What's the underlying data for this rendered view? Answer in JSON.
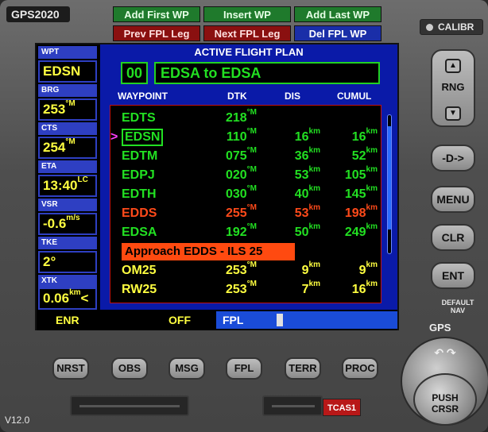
{
  "brand": "GPS2020",
  "top_buttons": [
    {
      "label": "Add First WP",
      "color": "green"
    },
    {
      "label": "Insert WP",
      "color": "green"
    },
    {
      "label": "Add Last WP",
      "color": "green"
    },
    {
      "label": "Prev FPL Leg",
      "color": "red"
    },
    {
      "label": "Next FPL Leg",
      "color": "red"
    },
    {
      "label": "Del FPL WP",
      "color": "blue"
    }
  ],
  "calibr": "CALIBR",
  "left_panel": {
    "wpt": {
      "label": "WPT",
      "value": "EDSN"
    },
    "brg": {
      "label": "BRG",
      "value": "253",
      "unit": "°M"
    },
    "cts": {
      "label": "CTS",
      "value": "254",
      "unit": "°M"
    },
    "eta": {
      "label": "ETA",
      "value": "13:40",
      "unit": "LC"
    },
    "vsr": {
      "label": "VSR",
      "value": "-0.6",
      "unit": "m/s"
    },
    "tke": {
      "label": "TKE",
      "value": "2°"
    },
    "xtk": {
      "label": "XTK",
      "value": "0.06",
      "unit": "km",
      "suffix": "<"
    }
  },
  "flight_plan": {
    "title": "ACTIVE FLIGHT PLAN",
    "number": "00",
    "name": "EDSA to EDSA",
    "columns": {
      "waypoint": "WAYPOINT",
      "dtk": "DTK",
      "dis": "DIS",
      "cumul": "CUMUL"
    },
    "rows": [
      {
        "wp": "EDTS",
        "dtk": "218",
        "dis": "",
        "cum": "",
        "color": "green",
        "active": false
      },
      {
        "wp": "EDSN",
        "dtk": "110",
        "dis": "16",
        "cum": "16",
        "color": "green",
        "active": true
      },
      {
        "wp": "EDTM",
        "dtk": "075",
        "dis": "36",
        "cum": "52",
        "color": "green",
        "active": false
      },
      {
        "wp": "EDPJ",
        "dtk": "020",
        "dis": "53",
        "cum": "105",
        "color": "green",
        "active": false
      },
      {
        "wp": "EDTH",
        "dtk": "030",
        "dis": "40",
        "cum": "145",
        "color": "green",
        "active": false
      },
      {
        "wp": "EDDS",
        "dtk": "255",
        "dis": "53",
        "cum": "198",
        "color": "red",
        "active": false
      },
      {
        "wp": "EDSA",
        "dtk": "192",
        "dis": "50",
        "cum": "249",
        "color": "green",
        "active": false
      }
    ],
    "approach": "Approach EDDS - ILS 25",
    "approach_rows": [
      {
        "wp": "OM25",
        "dtk": "253",
        "dis": "9",
        "cum": "9",
        "color": "yellow"
      },
      {
        "wp": "RW25",
        "dtk": "253",
        "dis": "7",
        "cum": "16",
        "color": "yellow"
      }
    ],
    "dtk_unit": "°M",
    "dist_unit": "km",
    "marker": ">"
  },
  "status": {
    "mode": "ENR",
    "state": "OFF",
    "page": "FPL"
  },
  "right_buttons": {
    "rng": "RNG",
    "direct": "-D->",
    "menu": "MENU",
    "clr": "CLR",
    "ent": "ENT",
    "default_nav": "DEFAULT NAV",
    "gps": "GPS"
  },
  "bottom_buttons": [
    "NRST",
    "OBS",
    "MSG",
    "FPL",
    "TERR",
    "PROC"
  ],
  "tcas": "TCAS1",
  "knob": {
    "label": "PUSH CRSR"
  },
  "version": "V12.0",
  "colors": {
    "green": "#22e022",
    "red": "#ff4a1a",
    "yellow": "#ffff40",
    "screen_blue": "#0a1aa8"
  }
}
